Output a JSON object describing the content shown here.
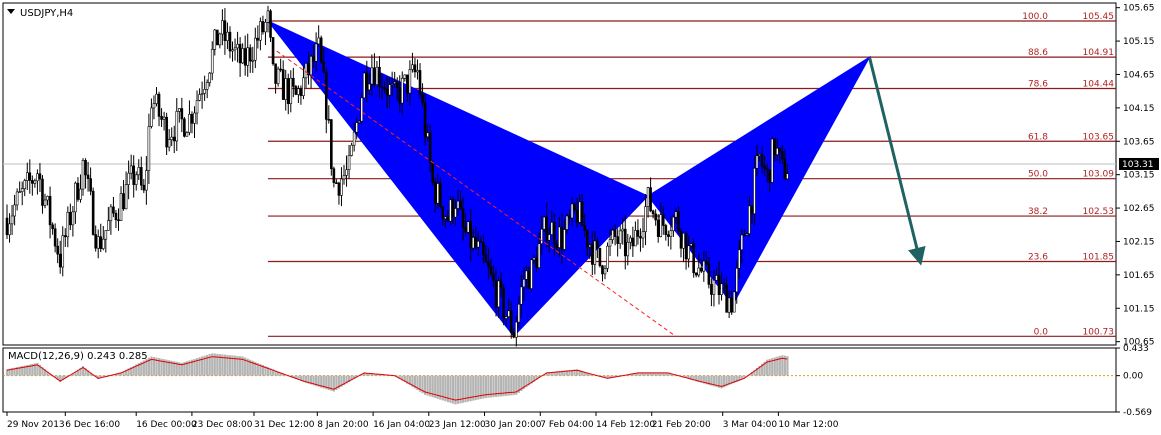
{
  "chart_data": {
    "type": "candlestick",
    "symbol_label": "USDJPY,H4",
    "x_ticks": [
      "29 Nov 2013",
      "6 Dec 16:00",
      "16 Dec 00:00",
      "23 Dec 08:00",
      "31 Dec 12:00",
      "8 Jan 20:00",
      "16 Jan 04:00",
      "23 Jan 12:00",
      "30 Jan 20:00",
      "7 Feb 04:00",
      "14 Feb 12:00",
      "21 Feb 20:00",
      "3 Mar 04:00",
      "10 Mar 12:00"
    ],
    "y_ticks": [
      "105.65",
      "105.15",
      "104.65",
      "104.15",
      "103.65",
      "103.15",
      "102.65",
      "102.15",
      "101.65",
      "101.15",
      "100.65"
    ],
    "ylim": [
      100.6,
      105.72
    ],
    "current_price": "103.31",
    "fib_levels": [
      {
        "pct": "100.0",
        "price": "105.45"
      },
      {
        "pct": "88.6",
        "price": "104.91"
      },
      {
        "pct": "78.6",
        "price": "104.44"
      },
      {
        "pct": "61.8",
        "price": "103.65"
      },
      {
        "pct": "50.0",
        "price": "103.09"
      },
      {
        "pct": "38.2",
        "price": "102.53"
      },
      {
        "pct": "23.6",
        "price": "101.85"
      },
      {
        "pct": "0.0",
        "price": "100.73"
      }
    ],
    "pattern_points": [
      {
        "date": "2014-01-02 08:00",
        "price": 105.45
      },
      {
        "date": "2014-02-03 16:00",
        "price": 100.73
      },
      {
        "date": "2014-02-21 08:00",
        "price": 102.83
      },
      {
        "date": "2014-03-04 12:00",
        "price": 101.2
      },
      {
        "date": "2014-03-22 12:00",
        "price": 104.91
      }
    ],
    "price_path": [
      {
        "date": "2013-11-29 00:00",
        "price": 102.5
      },
      {
        "date": "2013-12-03 00:00",
        "price": 103.2
      },
      {
        "date": "2013-12-06 00:00",
        "price": 101.9
      },
      {
        "date": "2013-12-09 00:00",
        "price": 103.3
      },
      {
        "date": "2013-12-11 00:00",
        "price": 102.1
      },
      {
        "date": "2013-12-16 00:00",
        "price": 103.2
      },
      {
        "date": "2013-12-17 00:00",
        "price": 102.8
      },
      {
        "date": "2013-12-18 00:00",
        "price": 104.3
      },
      {
        "date": "2013-12-20 00:00",
        "price": 103.8
      },
      {
        "date": "2013-12-23 00:00",
        "price": 104.0
      },
      {
        "date": "2013-12-25 00:00",
        "price": 104.6
      },
      {
        "date": "2013-12-27 00:00",
        "price": 105.3
      },
      {
        "date": "2013-12-30 00:00",
        "price": 104.8
      },
      {
        "date": "2014-01-02 08:00",
        "price": 105.45
      },
      {
        "date": "2014-01-03 00:00",
        "price": 104.6
      },
      {
        "date": "2014-01-06 00:00",
        "price": 104.3
      },
      {
        "date": "2014-01-09 00:00",
        "price": 105.0
      },
      {
        "date": "2014-01-10 00:00",
        "price": 104.2
      },
      {
        "date": "2014-01-11 00:00",
        "price": 103.0
      },
      {
        "date": "2014-01-13 00:00",
        "price": 103.2
      },
      {
        "date": "2014-01-15 00:00",
        "price": 104.6
      },
      {
        "date": "2014-01-16 00:00",
        "price": 104.8
      },
      {
        "date": "2014-01-19 00:00",
        "price": 104.3
      },
      {
        "date": "2014-01-22 00:00",
        "price": 104.7
      },
      {
        "date": "2014-01-24 00:00",
        "price": 103.0
      },
      {
        "date": "2014-01-26 00:00",
        "price": 102.5
      },
      {
        "date": "2014-01-27 00:00",
        "price": 102.8
      },
      {
        "date": "2014-01-28 00:00",
        "price": 102.3
      },
      {
        "date": "2014-01-30 00:00",
        "price": 102.0
      },
      {
        "date": "2014-02-01 00:00",
        "price": 101.5
      },
      {
        "date": "2014-02-03 16:00",
        "price": 100.8
      },
      {
        "date": "2014-02-05 00:00",
        "price": 101.6
      },
      {
        "date": "2014-02-06 00:00",
        "price": 101.7
      },
      {
        "date": "2014-02-08 00:00",
        "price": 102.4
      },
      {
        "date": "2014-02-10 00:00",
        "price": 102.2
      },
      {
        "date": "2014-02-12 00:00",
        "price": 102.6
      },
      {
        "date": "2014-02-13 00:00",
        "price": 102.3
      },
      {
        "date": "2014-02-15 00:00",
        "price": 101.8
      },
      {
        "date": "2014-02-17 00:00",
        "price": 102.2
      },
      {
        "date": "2014-02-19 00:00",
        "price": 102.0
      },
      {
        "date": "2014-02-21 08:00",
        "price": 102.75
      },
      {
        "date": "2014-02-23 00:00",
        "price": 102.4
      },
      {
        "date": "2014-02-25 00:00",
        "price": 102.5
      },
      {
        "date": "2014-02-27 00:00",
        "price": 101.9
      },
      {
        "date": "2014-03-01 00:00",
        "price": 101.6
      },
      {
        "date": "2014-03-03 00:00",
        "price": 101.4
      },
      {
        "date": "2014-03-04 12:00",
        "price": 101.25
      },
      {
        "date": "2014-03-06 00:00",
        "price": 102.3
      },
      {
        "date": "2014-03-07 00:00",
        "price": 102.8
      },
      {
        "date": "2014-03-08 00:00",
        "price": 103.4
      },
      {
        "date": "2014-03-09 00:00",
        "price": 103.1
      },
      {
        "date": "2014-03-10 00:00",
        "price": 103.6
      },
      {
        "date": "2014-03-11 00:00",
        "price": 103.2
      },
      {
        "date": "2014-03-12 00:00",
        "price": 103.3
      }
    ],
    "projection": {
      "from": {
        "date": "2014-03-22 12:00",
        "price": 104.9
      },
      "to": {
        "date": "2014-03-29 00:00",
        "price": 101.92
      }
    },
    "trendline": {
      "from": {
        "date": "2014-01-03 12:00",
        "price": 105.0
      },
      "to": {
        "date": "2014-02-25 00:00",
        "price": 100.73
      }
    },
    "macd": {
      "label": "MACD(12,26,9) 0.243 0.285",
      "y_ticks": [
        "0.433",
        "0.00",
        "-0.569"
      ],
      "zero_label": "0.00",
      "ylim": [
        -0.569,
        0.433
      ],
      "path": [
        {
          "date": "2013-11-29 00:00",
          "value": 0.1
        },
        {
          "date": "2013-12-03 00:00",
          "value": 0.2
        },
        {
          "date": "2013-12-06 00:00",
          "value": -0.1
        },
        {
          "date": "2013-12-09 00:00",
          "value": 0.15
        },
        {
          "date": "2013-12-11 00:00",
          "value": -0.05
        },
        {
          "date": "2013-12-14 00:00",
          "value": 0.05
        },
        {
          "date": "2013-12-18 00:00",
          "value": 0.3
        },
        {
          "date": "2013-12-22 00:00",
          "value": 0.2
        },
        {
          "date": "2013-12-26 00:00",
          "value": 0.35
        },
        {
          "date": "2013-12-30 00:00",
          "value": 0.3
        },
        {
          "date": "2014-01-03 00:00",
          "value": 0.1
        },
        {
          "date": "2014-01-07 00:00",
          "value": -0.1
        },
        {
          "date": "2014-01-11 00:00",
          "value": -0.25
        },
        {
          "date": "2014-01-15 00:00",
          "value": 0.05
        },
        {
          "date": "2014-01-19 00:00",
          "value": 0.0
        },
        {
          "date": "2014-01-23 00:00",
          "value": -0.3
        },
        {
          "date": "2014-01-27 00:00",
          "value": -0.45
        },
        {
          "date": "2014-01-31 00:00",
          "value": -0.35
        },
        {
          "date": "2014-02-04 00:00",
          "value": -0.3
        },
        {
          "date": "2014-02-08 00:00",
          "value": 0.05
        },
        {
          "date": "2014-02-12 00:00",
          "value": 0.1
        },
        {
          "date": "2014-02-16 00:00",
          "value": -0.05
        },
        {
          "date": "2014-02-20 00:00",
          "value": 0.05
        },
        {
          "date": "2014-02-24 00:00",
          "value": 0.05
        },
        {
          "date": "2014-02-28 00:00",
          "value": -0.1
        },
        {
          "date": "2014-03-03 00:00",
          "value": -0.2
        },
        {
          "date": "2014-03-06 00:00",
          "value": -0.05
        },
        {
          "date": "2014-03-09 00:00",
          "value": 0.25
        },
        {
          "date": "2014-03-11 00:00",
          "value": 0.32
        },
        {
          "date": "2014-03-12 00:00",
          "value": 0.3
        }
      ]
    },
    "colors": {
      "pattern_fill": "#0000ff",
      "fib_line": "#8b1a1a",
      "fib_text": "#b22222",
      "candle": "#000000",
      "macd_hist": "#b4b4b4",
      "macd_signal": "#e00000",
      "macd_zero": "#d4a017",
      "arrow": "#1f6262",
      "trendline": "#ff2020",
      "price_tag_bg": "#000000",
      "price_tag_text": "#ffffff"
    }
  }
}
